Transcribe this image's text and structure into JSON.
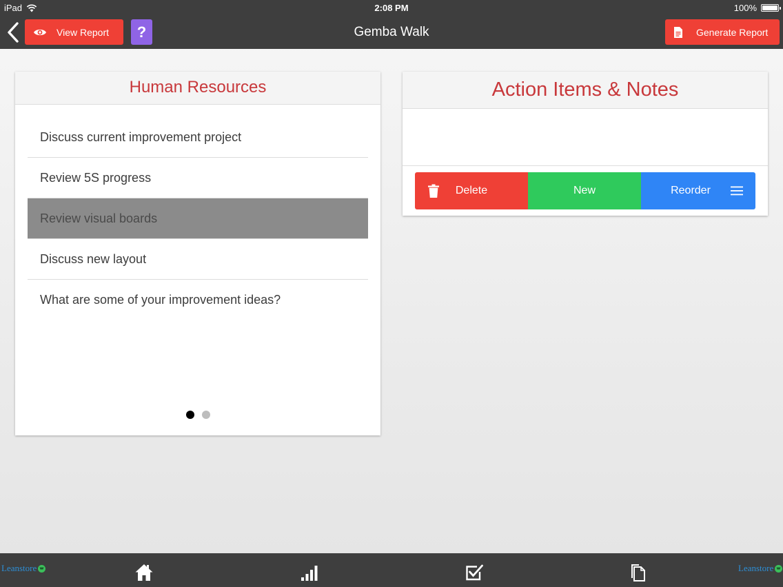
{
  "status_bar": {
    "carrier": "iPad",
    "time": "2:08 PM",
    "battery": "100%"
  },
  "nav": {
    "view_report_label": "View Report",
    "help_label": "?",
    "title": "Gemba Walk",
    "generate_report_label": "Generate Report"
  },
  "topics_panel": {
    "title": "Human Resources",
    "items": [
      "Discuss current improvement project",
      "Review 5S progress",
      "Review visual boards",
      "Discuss new layout",
      "What are some of your improvement ideas?"
    ],
    "selected_item": "Review visual boards",
    "page_count": 2,
    "current_page": 1
  },
  "actions_panel": {
    "title": "Action Items & Notes",
    "notes": "",
    "delete_label": "Delete",
    "new_label": "New",
    "reorder_label": "Reorder"
  },
  "tabbar": {
    "tabs": [
      "home-icon",
      "bar-chart-icon",
      "checklist-icon",
      "documents-icon"
    ],
    "brand_left": "Leanstore",
    "brand_right": "Leanstore"
  },
  "colors": {
    "bar_background": "#3e3e3e",
    "accent_red": "#ef4036",
    "help_purple": "#8f64e6",
    "header_text_red": "#c8383b",
    "new_green": "#2fca5c",
    "reorder_blue": "#2f85f6",
    "selected_row_gray": "#8b8b8b"
  }
}
